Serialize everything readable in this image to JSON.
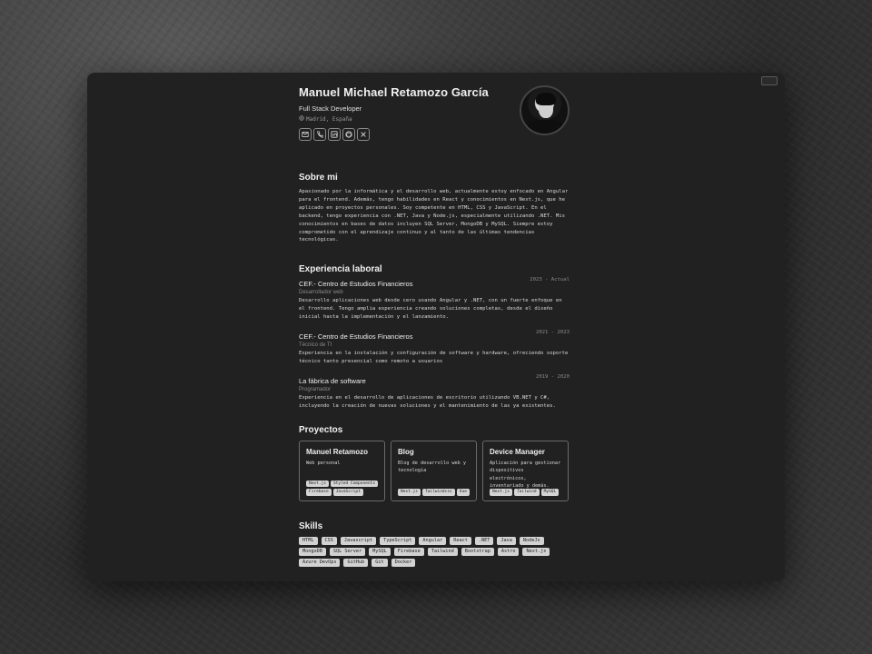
{
  "profile": {
    "name": "Manuel Michael Retamozo García",
    "role": "Full Stack Developer",
    "location": "Madrid, España",
    "socials": [
      "mail-icon",
      "phone-icon",
      "linkedin-icon",
      "github-icon",
      "x-icon"
    ]
  },
  "about": {
    "title": "Sobre mi",
    "text": "Apasionado por la informática y el desarrollo web, actualmente estoy enfocado en Angular para el frontend. Además, tengo habilidades en React y conocimientos en Next.js, que he aplicado en proyectos personales. Soy competente en HTML, CSS y JavaScript. En el backend, tengo experiencia con .NET, Java y Node.js, especialmente utilizando .NET. Mis conocimientos en bases de datos incluyen SQL Server, MongoDB y MySQL. Siempre estoy comprometido con el aprendizaje continuo y al tanto de las últimas tendencias tecnológicas."
  },
  "experience": {
    "title": "Experiencia laboral",
    "jobs": [
      {
        "company": "CEF.- Centro de Estudios Financieros",
        "role": "Desarrollador web",
        "dates": "2023 - Actual",
        "description": "Desarrollo aplicaciones web desde cero usando Angular y .NET, con un fuerte enfoque en el frontend. Tengo amplia experiencia creando soluciones completas, desde el diseño inicial hasta la implementación y el lanzamiento."
      },
      {
        "company": "CEF.- Centro de Estudios Financieros",
        "role": "Técnico de TI",
        "dates": "2021 - 2023",
        "description": "Experiencia en la instalación y configuración de software y hardware, ofreciendo soporte técnico tanto presencial como remoto a usuarios"
      },
      {
        "company": "La fábrica de software",
        "role": "Programador",
        "dates": "2019 - 2020",
        "description": "Experiencia en el desarrollo de aplicaciones de escritorio utilizando VB.NET y C#, incluyendo la creación de nuevas soluciones y el mantenimiento de las ya existentes."
      }
    ]
  },
  "projects": {
    "title": "Proyectos",
    "items": [
      {
        "title": "Manuel Retamozo",
        "description": "Web personal",
        "tags": [
          "Next.js",
          "Styled Components",
          "Firebase",
          "JavaScript"
        ]
      },
      {
        "title": "Blog",
        "description": "Blog de desarrollo web y tecnología",
        "tags": [
          "Next.js",
          "Tailwindcss",
          "Vue"
        ]
      },
      {
        "title": "Device Manager",
        "description": "Aplicación para gestionar dispositivos electrónicos, inventariado y demás.",
        "tags": [
          "Next.js",
          "Tailwind",
          "MySQL"
        ]
      }
    ]
  },
  "skills": {
    "title": "Skills",
    "items": [
      "HTML",
      "CSS",
      "Javascript",
      "TypeScript",
      "Angular",
      "React",
      ".NET",
      "Java",
      "NodeJs",
      "MongoDB",
      "SQL Server",
      "MySQL",
      "Firebase",
      "Tailwind",
      "Bootstrap",
      "Astro",
      "Next.js",
      "Azure DevOps",
      "GitHub",
      "Git",
      "Docker"
    ]
  }
}
